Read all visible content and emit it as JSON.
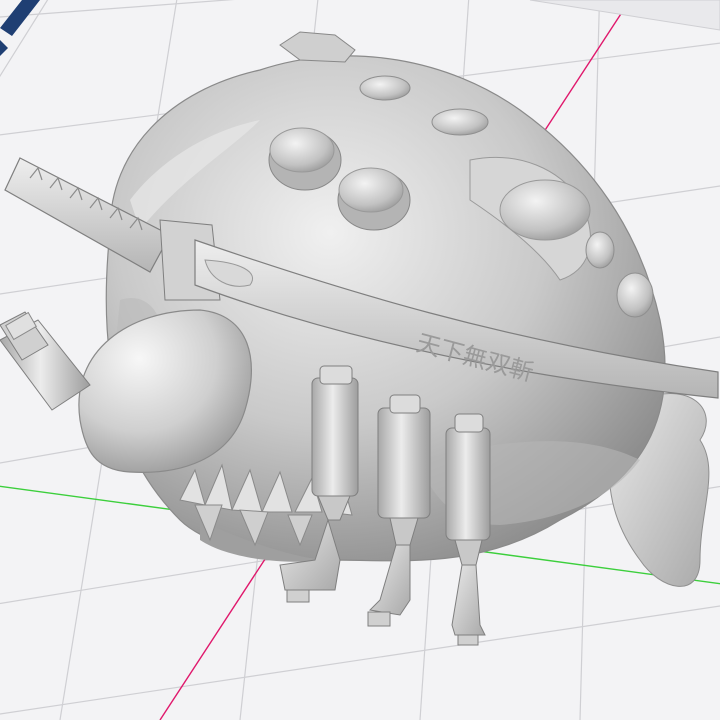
{
  "viewport": {
    "background": "#f3f3f5",
    "grid_color": "#cfcfd3",
    "x_axis_color": "#e0186c",
    "y_axis_color": "#3ccf3c",
    "corner_accent_color": "#1f3f73"
  },
  "model": {
    "body_color": "#c9c9c9",
    "shade_color": "#9e9e9e",
    "highlight_color": "#f2f2f2",
    "katana_inscription": "天下無双斬"
  }
}
